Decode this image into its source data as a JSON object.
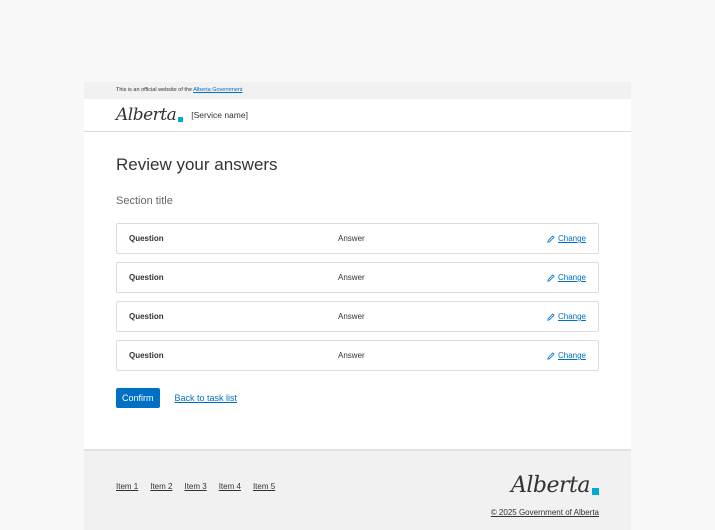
{
  "official_bar": {
    "prefix": "This is an official website of the",
    "link": "Alberta Government"
  },
  "header": {
    "logo": "Alberta",
    "service_name": "[Service name]"
  },
  "main": {
    "title": "Review your answers",
    "section_title": "Section title",
    "rows": [
      {
        "question": "Question",
        "answer": "Answer",
        "change": "Change"
      },
      {
        "question": "Question",
        "answer": "Answer",
        "change": "Change"
      },
      {
        "question": "Question",
        "answer": "Answer",
        "change": "Change"
      },
      {
        "question": "Question",
        "answer": "Answer",
        "change": "Change"
      }
    ],
    "confirm_label": "Confirm",
    "back_label": "Back to task list"
  },
  "footer": {
    "nav": [
      "Item 1",
      "Item 2",
      "Item 3",
      "Item 4",
      "Item 5"
    ],
    "logo": "Alberta",
    "copyright": "© 2025 Government of Alberta"
  },
  "colors": {
    "accent": "#0070c4",
    "flag": "#00aad2"
  },
  "icons": {
    "change": "pencil-icon"
  }
}
